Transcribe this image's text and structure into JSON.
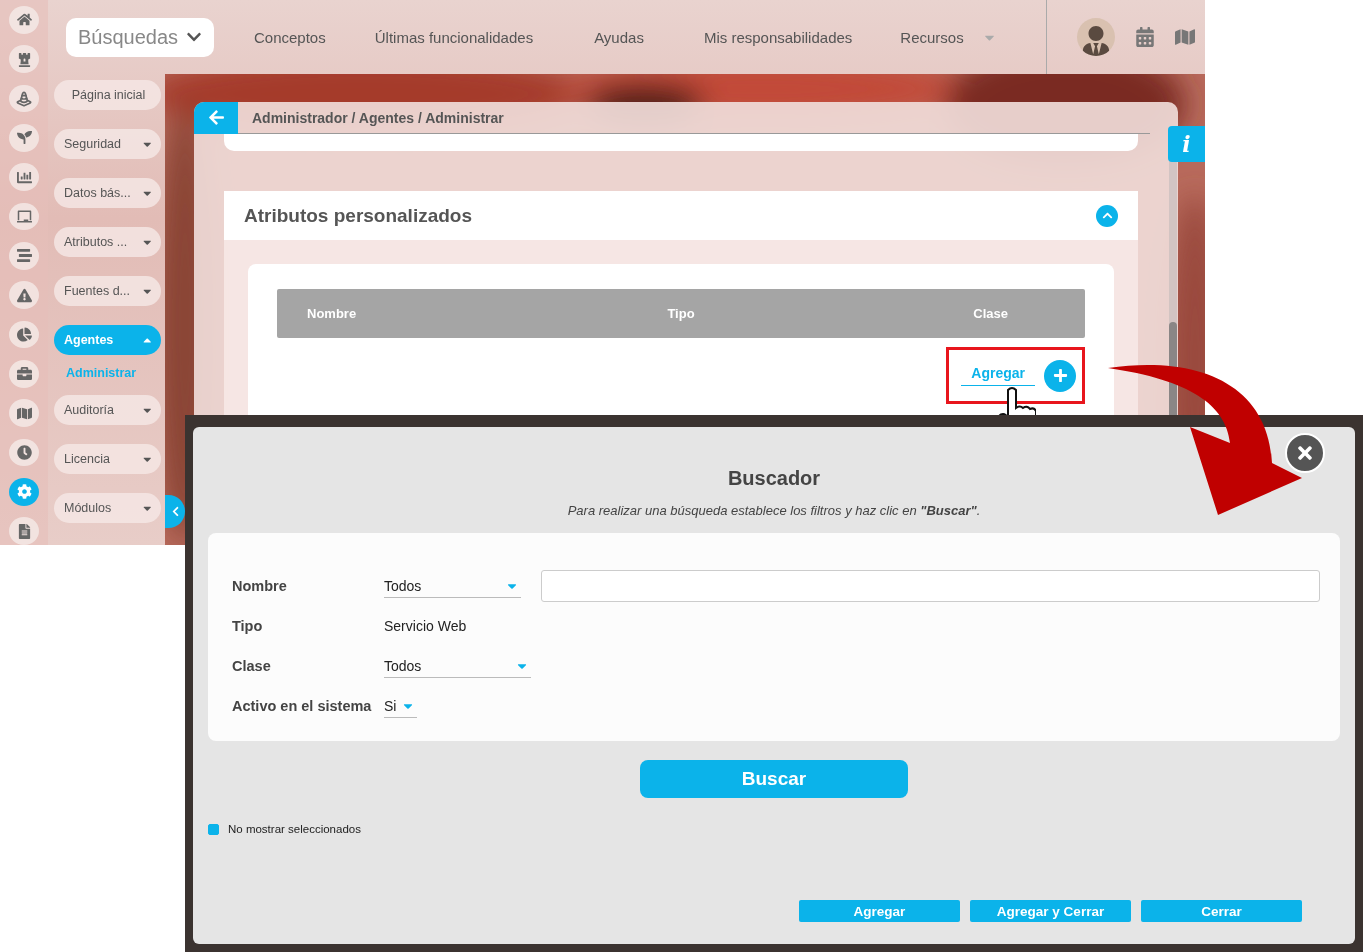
{
  "app_screen": {
    "top_nav": {
      "search_menu": "Búsquedas",
      "links": [
        "Conceptos",
        "Últimas funcionalidades",
        "Ayudas",
        "Mis responsabilidades",
        "Recursos"
      ]
    },
    "icon_rail": [
      {
        "kind": "home",
        "selected": false
      },
      {
        "kind": "rook",
        "selected": false
      },
      {
        "kind": "cone",
        "selected": false
      },
      {
        "kind": "sprout",
        "selected": false
      },
      {
        "kind": "chart",
        "selected": false
      },
      {
        "kind": "board",
        "selected": false
      },
      {
        "kind": "lines",
        "selected": false
      },
      {
        "kind": "warning",
        "selected": false
      },
      {
        "kind": "pie",
        "selected": false
      },
      {
        "kind": "briefcase",
        "selected": false
      },
      {
        "kind": "map",
        "selected": false
      },
      {
        "kind": "clock",
        "selected": false
      },
      {
        "kind": "gear",
        "selected": true
      },
      {
        "kind": "document",
        "selected": false
      }
    ],
    "menu": [
      {
        "label": "Página inicial",
        "kind": "link",
        "selected": false
      },
      {
        "label": "Seguridad",
        "kind": "group",
        "selected": false,
        "expanded": false
      },
      {
        "label": "Datos bás...",
        "kind": "group",
        "selected": false,
        "expanded": false
      },
      {
        "label": "Atributos ...",
        "kind": "group",
        "selected": false,
        "expanded": false
      },
      {
        "label": "Fuentes d...",
        "kind": "group",
        "selected": false,
        "expanded": false
      },
      {
        "label": "Agentes",
        "kind": "group",
        "selected": true,
        "expanded": true,
        "children": [
          {
            "label": "Administrar",
            "selected": true
          }
        ]
      },
      {
        "label": "Auditoría",
        "kind": "group",
        "selected": false,
        "expanded": false
      },
      {
        "label": "Licencia",
        "kind": "group",
        "selected": false,
        "expanded": false
      },
      {
        "label": "Módulos",
        "kind": "group",
        "selected": false,
        "expanded": false
      }
    ],
    "breadcrumb": "Administrador / Agentes / Administrar",
    "info_button": "i",
    "section": {
      "title": "Atributos personalizados",
      "expanded": true,
      "columns": [
        "Nombre",
        "Tipo",
        "Clase"
      ],
      "add_link": "Agregar"
    }
  },
  "dialog": {
    "title": "Buscador",
    "subtitle": "Para realizar una búsqueda establece los filtros y haz clic en **\"Buscar\"**.",
    "fields": [
      {
        "label": "Nombre",
        "kind": "select_text",
        "value": "Todos"
      },
      {
        "label": "Tipo",
        "kind": "static",
        "value": "Servicio Web"
      },
      {
        "label": "Clase",
        "kind": "select",
        "value": "Todos"
      },
      {
        "label": "Activo en el sistema",
        "kind": "select_short",
        "value": "Si"
      }
    ],
    "search_button": "Buscar",
    "checkbox": {
      "label": "No mostrar seleccionados",
      "checked": true
    },
    "buttons": [
      "Agregar",
      "Agregar y Cerrar",
      "Cerrar"
    ]
  }
}
